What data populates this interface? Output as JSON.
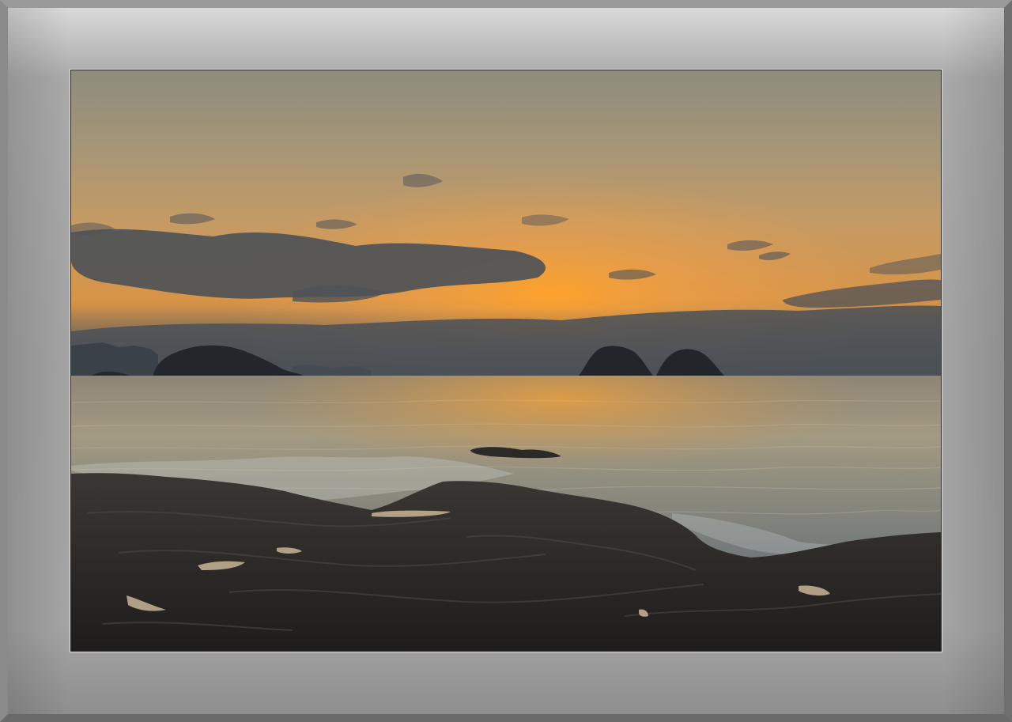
{
  "scene": {
    "description_icons": [
      "sun-glow",
      "island",
      "rock",
      "cloud"
    ],
    "colors": {
      "outer_frame": "#7d7d7d",
      "mat_top": "#d9d9d9",
      "mat_mid": "#a4a4a4",
      "photo_border": "#e6e6e6",
      "sky_top": "#8d8a78",
      "sky_glow": "#f39a2a",
      "sea": "#a59c84",
      "rock": "#2a2826"
    }
  }
}
